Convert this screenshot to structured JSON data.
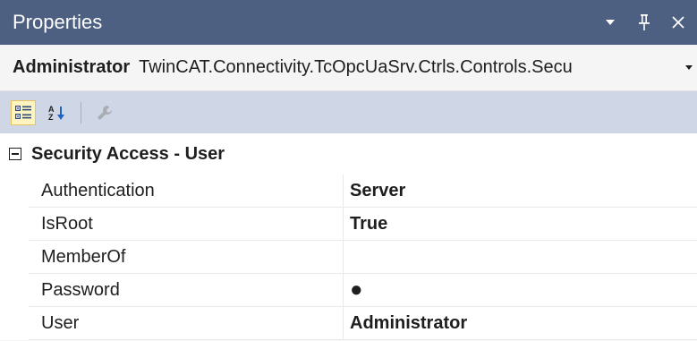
{
  "window": {
    "title": "Properties",
    "buttons": {
      "menu_icon": "dropdown-arrow-icon",
      "pin_icon": "pin-icon",
      "close_icon": "close-icon"
    }
  },
  "selector": {
    "object_name": "Administrator",
    "object_type": "TwinCAT.Connectivity.TcOpcUaSrv.Ctrls.Controls.Secu"
  },
  "toolbar": {
    "items": [
      {
        "icon": "categorized-view-icon",
        "active": true
      },
      {
        "icon": "alphabetical-sort-icon",
        "active": false
      },
      {
        "icon": "property-pages-wrench-icon",
        "active": false
      }
    ]
  },
  "grid": {
    "category": {
      "label": "Security Access - User",
      "expanded": true
    },
    "properties": [
      {
        "name": "Authentication",
        "value": "Server"
      },
      {
        "name": "IsRoot",
        "value": "True"
      },
      {
        "name": "MemberOf",
        "value": ""
      },
      {
        "name": "Password",
        "value": "●"
      },
      {
        "name": "User",
        "value": "Administrator"
      }
    ]
  },
  "colors": {
    "titlebar": "#4d6082",
    "toolbar": "#cfd6e5",
    "active_tool": "#fdf4bf"
  }
}
